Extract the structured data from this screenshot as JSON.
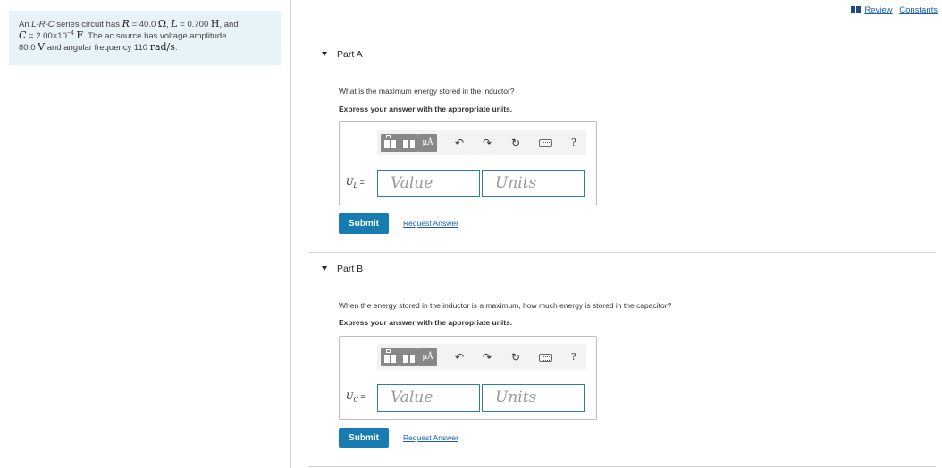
{
  "problem": {
    "text_1": "An ",
    "circuit": "L-R-C",
    "text_2": " series circuit has ",
    "R_sym": "R",
    "text_3": " = 40.0 ",
    "R_unit": "Ω",
    "text_4": ", ",
    "L_sym": "L",
    "text_5": " = 0.700 ",
    "L_unit": "H",
    "text_6": ", and",
    "C_sym": "C",
    "text_7": " = 2.00×10",
    "C_exp": "−4",
    "text_8": " ",
    "C_unit": "F",
    "text_9": ". The ac source has voltage amplitude",
    "text_10": "80.0 ",
    "V_unit": "V",
    "text_11": " and angular frequency 110 ",
    "w_unit": "rad/s",
    "text_12": "."
  },
  "top_links": {
    "review": "Review",
    "separator": " | ",
    "constants": "Constants"
  },
  "toolbar": {
    "units_symbol": "μÅ",
    "undo": "↶",
    "redo": "↷",
    "reset": "↻",
    "help": "?"
  },
  "parts": [
    {
      "title": "Part A",
      "question": "What is the maximum energy stored in the inductor?",
      "instruction": "Express your answer with the appropriate units.",
      "var_symbol": "U",
      "var_sub": "L",
      "var_eq": " =",
      "value_placeholder": "Value",
      "units_placeholder": "Units",
      "submit_label": "Submit",
      "request_label": "Request Answer"
    },
    {
      "title": "Part B",
      "question": "When the energy stored in the inductor is a maximum, how much energy is stored in the capacitor?",
      "instruction": "Express your answer with the appropriate units.",
      "var_symbol": "U",
      "var_sub": "C",
      "var_eq": " =",
      "value_placeholder": "Value",
      "units_placeholder": "Units",
      "submit_label": "Submit",
      "request_label": "Request Answer"
    }
  ]
}
